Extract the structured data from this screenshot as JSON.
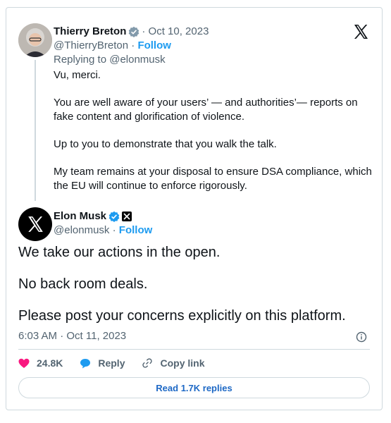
{
  "parent": {
    "name": "Thierry Breton",
    "date": "· Oct 10, 2023",
    "handle": "@ThierryBreton",
    "sep": "·",
    "follow": "Follow",
    "replying": "Replying to @elonmusk",
    "paragraphs": [
      "Vu, merci.",
      "You are well aware of your users’ — and authorities’— reports on fake content and glorification of violence.",
      "Up to you to demonstrate that you walk the talk.",
      "My team remains at your disposal to ensure DSA compliance, which the EU will continue to enforce rigorously."
    ]
  },
  "main": {
    "name": "Elon Musk",
    "handle": "@elonmusk",
    "sep": "·",
    "follow": "Follow",
    "paragraphs": [
      "We take our actions in the open.",
      "No back room deals.",
      "Please post your concerns explicitly on this platform."
    ],
    "timestamp": "6:03 AM · Oct 11, 2023"
  },
  "actions": {
    "likes": "24.8K",
    "reply": "Reply",
    "copy": "Copy link"
  },
  "read_replies": "Read 1.7K replies",
  "colors": {
    "accent": "#1d9bf0",
    "like": "#f91880",
    "muted": "#536471",
    "border": "#cfd9de"
  },
  "icons": [
    "x-logo-icon",
    "verified-icon",
    "heart-icon",
    "reply-bubble-icon",
    "link-icon",
    "info-icon"
  ]
}
